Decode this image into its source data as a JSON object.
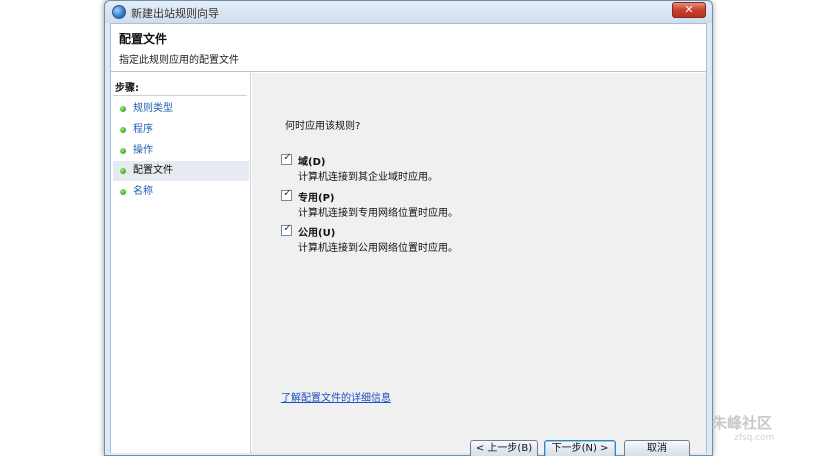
{
  "window": {
    "title": "新建出站规则向导",
    "close_label": "✕"
  },
  "header": {
    "title": "配置文件",
    "subtitle": "指定此规则应用的配置文件"
  },
  "steps": {
    "title": "步骤:",
    "items": [
      {
        "label": "规则类型",
        "current": false
      },
      {
        "label": "程序",
        "current": false
      },
      {
        "label": "操作",
        "current": false
      },
      {
        "label": "配置文件",
        "current": true
      },
      {
        "label": "名称",
        "current": false
      }
    ]
  },
  "content": {
    "question": "何时应用该规则?",
    "options": [
      {
        "label": "域(D)",
        "description": "计算机连接到其企业域时应用。",
        "checked": true
      },
      {
        "label": "专用(P)",
        "description": "计算机连接到专用网络位置时应用。",
        "checked": true
      },
      {
        "label": "公用(U)",
        "description": "计算机连接到公用网络位置时应用。",
        "checked": true
      }
    ],
    "link": "了解配置文件的详细信息"
  },
  "buttons": {
    "back": "< 上一步(B)",
    "next": "下一步(N) >",
    "cancel": "取消"
  },
  "watermark": {
    "main": "朱峰社区",
    "sub": "zfsq.com"
  },
  "colors": {
    "link": "#1f4fc0",
    "step_link": "#1f5fb0",
    "window_frame": "#dfe9f5"
  }
}
